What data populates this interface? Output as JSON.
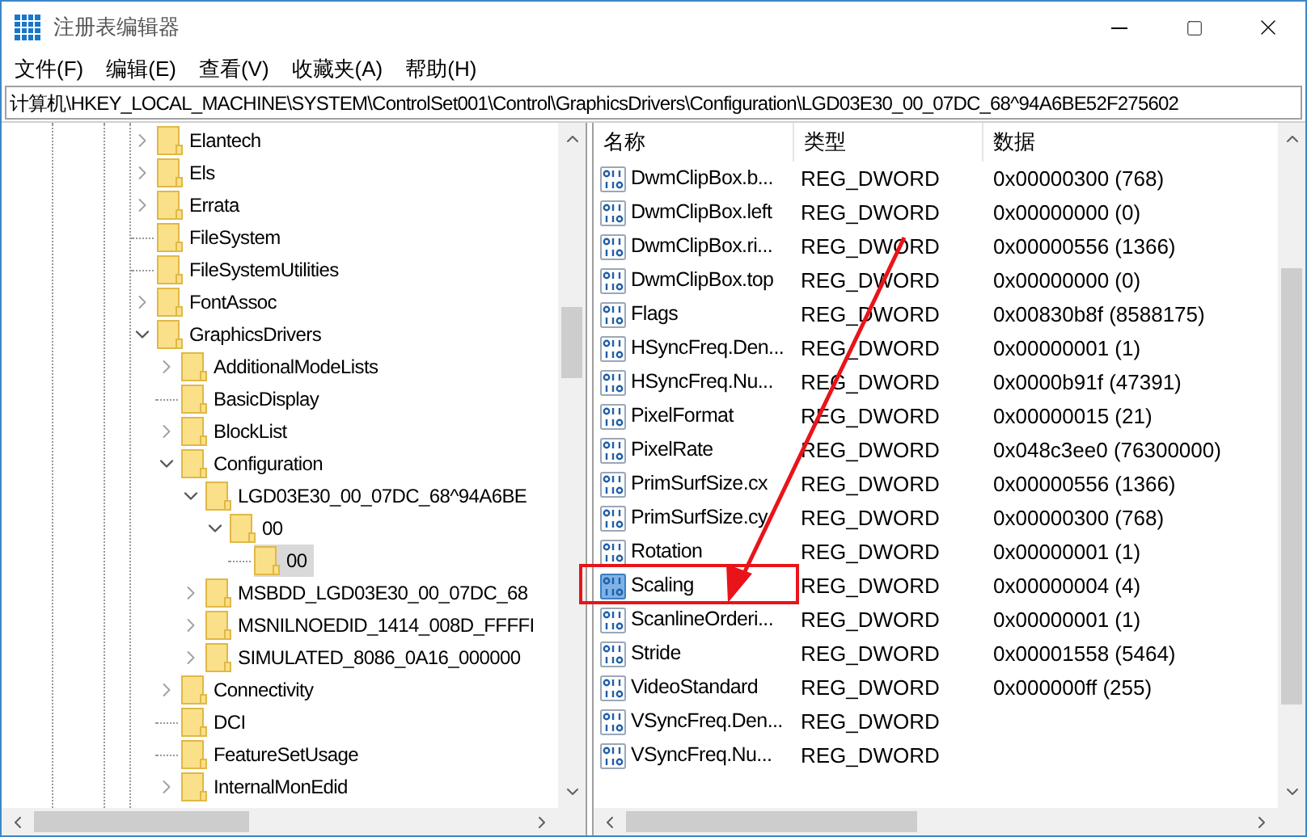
{
  "window": {
    "title": "注册表编辑器"
  },
  "menu": [
    {
      "label": "文件(F)"
    },
    {
      "label": "编辑(E)"
    },
    {
      "label": "查看(V)"
    },
    {
      "label": "收藏夹(A)"
    },
    {
      "label": "帮助(H)"
    }
  ],
  "address": "计算机\\HKEY_LOCAL_MACHINE\\SYSTEM\\ControlSet001\\Control\\GraphicsDrivers\\Configuration\\LGD03E30_00_07DC_68^94A6BE52F275602",
  "tree": [
    {
      "label": "Elantech",
      "kind": "branch",
      "expanded": false,
      "selected": false
    },
    {
      "label": "Els",
      "kind": "branch",
      "expanded": false,
      "selected": false
    },
    {
      "label": "Errata",
      "kind": "branch",
      "expanded": false,
      "selected": false
    },
    {
      "label": "FileSystem",
      "kind": "leaf",
      "selected": false
    },
    {
      "label": "FileSystemUtilities",
      "kind": "leaf",
      "selected": false
    },
    {
      "label": "FontAssoc",
      "kind": "branch",
      "expanded": false,
      "selected": false
    },
    {
      "label": "GraphicsDrivers",
      "kind": "branch",
      "expanded": true,
      "selected": false,
      "children": [
        {
          "label": "AdditionalModeLists",
          "kind": "branch",
          "expanded": false,
          "selected": false
        },
        {
          "label": "BasicDisplay",
          "kind": "leaf",
          "selected": false
        },
        {
          "label": "BlockList",
          "kind": "branch",
          "expanded": false,
          "selected": false
        },
        {
          "label": "Configuration",
          "kind": "branch",
          "expanded": true,
          "selected": false,
          "children": [
            {
              "label": "LGD03E30_00_07DC_68^94A6BE",
              "kind": "branch",
              "expanded": true,
              "selected": false,
              "children": [
                {
                  "label": "00",
                  "kind": "branch",
                  "expanded": true,
                  "selected": false,
                  "children": [
                    {
                      "label": "00",
                      "kind": "leaf",
                      "selected": true
                    }
                  ]
                }
              ]
            },
            {
              "label": "MSBDD_LGD03E30_00_07DC_68",
              "kind": "branch",
              "expanded": false,
              "selected": false
            },
            {
              "label": "MSNILNOEDID_1414_008D_FFFFI",
              "kind": "branch",
              "expanded": false,
              "selected": false
            },
            {
              "label": "SIMULATED_8086_0A16_000000",
              "kind": "branch",
              "expanded": false,
              "selected": false
            }
          ]
        },
        {
          "label": "Connectivity",
          "kind": "branch",
          "expanded": false,
          "selected": false
        },
        {
          "label": "DCI",
          "kind": "leaf",
          "selected": false
        },
        {
          "label": "FeatureSetUsage",
          "kind": "leaf",
          "selected": false
        },
        {
          "label": "InternalMonEdid",
          "kind": "branch",
          "expanded": false,
          "selected": false
        }
      ]
    }
  ],
  "values": {
    "columns": [
      "名称",
      "类型",
      "数据"
    ],
    "rows": [
      {
        "name": "DwmClipBox.b...",
        "type": "REG_DWORD",
        "data": "0x00000300 (768)",
        "selected": false
      },
      {
        "name": "DwmClipBox.left",
        "type": "REG_DWORD",
        "data": "0x00000000 (0)",
        "selected": false
      },
      {
        "name": "DwmClipBox.ri...",
        "type": "REG_DWORD",
        "data": "0x00000556 (1366)",
        "selected": false
      },
      {
        "name": "DwmClipBox.top",
        "type": "REG_DWORD",
        "data": "0x00000000 (0)",
        "selected": false
      },
      {
        "name": "Flags",
        "type": "REG_DWORD",
        "data": "0x00830b8f (8588175)",
        "selected": false
      },
      {
        "name": "HSyncFreq.Den...",
        "type": "REG_DWORD",
        "data": "0x00000001 (1)",
        "selected": false
      },
      {
        "name": "HSyncFreq.Nu...",
        "type": "REG_DWORD",
        "data": "0x0000b91f (47391)",
        "selected": false
      },
      {
        "name": "PixelFormat",
        "type": "REG_DWORD",
        "data": "0x00000015 (21)",
        "selected": false
      },
      {
        "name": "PixelRate",
        "type": "REG_DWORD",
        "data": "0x048c3ee0 (76300000)",
        "selected": false
      },
      {
        "name": "PrimSurfSize.cx",
        "type": "REG_DWORD",
        "data": "0x00000556 (1366)",
        "selected": false
      },
      {
        "name": "PrimSurfSize.cy",
        "type": "REG_DWORD",
        "data": "0x00000300 (768)",
        "selected": false
      },
      {
        "name": "Rotation",
        "type": "REG_DWORD",
        "data": "0x00000001 (1)",
        "selected": false
      },
      {
        "name": "Scaling",
        "type": "REG_DWORD",
        "data": "0x00000004 (4)",
        "selected": true
      },
      {
        "name": "ScanlineOrderi...",
        "type": "REG_DWORD",
        "data": "0x00000001 (1)",
        "selected": false
      },
      {
        "name": "Stride",
        "type": "REG_DWORD",
        "data": "0x00001558 (5464)",
        "selected": false
      },
      {
        "name": "VideoStandard",
        "type": "REG_DWORD",
        "data": "0x000000ff (255)",
        "selected": false
      },
      {
        "name": "VSyncFreq.Den...",
        "type": "REG_DWORD",
        "selected": false
      },
      {
        "name": "VSyncFreq.Nu...",
        "type": "REG_DWORD",
        "selected": false
      }
    ]
  }
}
